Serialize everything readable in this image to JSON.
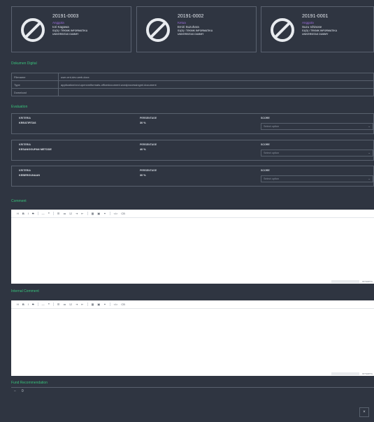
{
  "members": [
    {
      "nim": "20191-0003",
      "role": "Anggota",
      "name": "Iori Kagawa",
      "program": "S1(D) / TEKNIK INFORMATIKA",
      "university": "UNIVERSITAS DUMMY"
    },
    {
      "nim": "20191-0002",
      "role": "Ketua",
      "name": "Emiri Suzuhara",
      "program": "S1(D) / TEKNIK INFORMATIKA",
      "university": "UNIVERSITAS DUMMY"
    },
    {
      "nim": "20191-0001",
      "role": "Anggota",
      "name": "Suzu Ichinose",
      "program": "S1(D) / TEKNIK INFORMATIKA",
      "university": "UNIVERSITAS DUMMY"
    }
  ],
  "document": {
    "section_label": "Dokumen Digital",
    "rows": [
      {
        "key": "Filename",
        "value": "user-ent-dev-web.docx"
      },
      {
        "key": "Type",
        "value": "application/vnd.openxmlformats-officedocument.wordprocessingml.document"
      },
      {
        "key": "Download",
        "value": ""
      }
    ]
  },
  "evaluation": {
    "section_label": "Evaluation",
    "header_kriteria": "KRITERIA",
    "header_persentase": "PERSENTASE",
    "header_score": "SCORE",
    "select_placeholder": "Select option",
    "items": [
      {
        "kriteria": "KREATIFITAS",
        "persentase": "30 %"
      },
      {
        "kriteria": "KESANGGUPAN METODE",
        "persentase": "40 %"
      },
      {
        "kriteria": "KEBERGUNAAN",
        "persentase": "30 %"
      }
    ]
  },
  "comment": {
    "section_label": "Comment",
    "char_count": "WYSIWYG"
  },
  "internal_comment": {
    "section_label": "Internal Comment",
    "char_count": "WYSIWYG"
  },
  "toolbar": {
    "h": "H",
    "bold": "B",
    "italic": "I",
    "strike": "S",
    "hr": "—",
    "quote": "❝",
    "ul": "☰",
    "ol": "≔",
    "task": "☑",
    "indent": "⇥",
    "outdent": "⇤",
    "table": "▦",
    "image": "▣",
    "link": "⚭",
    "code": "</>",
    "codeblock": "CB"
  },
  "fund": {
    "section_label": "Fund Recommendation",
    "minus": "−",
    "zero": "0"
  },
  "close_label": "×"
}
